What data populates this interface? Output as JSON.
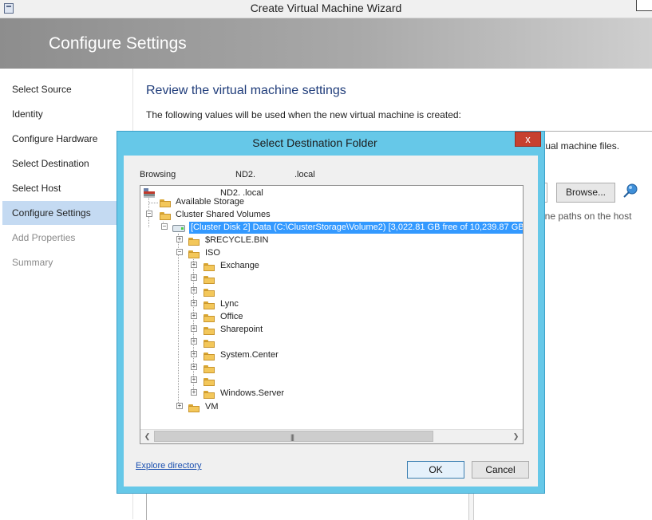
{
  "window": {
    "title": "Create Virtual Machine Wizard"
  },
  "banner": {
    "heading": "Configure Settings"
  },
  "sidebar": {
    "items": [
      {
        "label": "Select Source",
        "state": "normal"
      },
      {
        "label": "Identity",
        "state": "normal"
      },
      {
        "label": "Configure Hardware",
        "state": "normal"
      },
      {
        "label": "Select Destination",
        "state": "normal"
      },
      {
        "label": "Select Host",
        "state": "normal"
      },
      {
        "label": "Configure Settings",
        "state": "active"
      },
      {
        "label": "Add Properties",
        "state": "disabled"
      },
      {
        "label": "Summary",
        "state": "disabled"
      }
    ]
  },
  "main": {
    "title": "Review the virtual machine settings",
    "description": "The following values will be used when the new virtual machine is created:",
    "behind_text_1": "tual machine files.",
    "behind_text_2": "ine paths on the host",
    "browse_label": "Browse..."
  },
  "dialog": {
    "title": "Select Destination Folder",
    "close_label": "x",
    "browsing_label": "Browsing",
    "browsing_server": "ND2.                .local",
    "tree": {
      "root": "ND2.               .local",
      "available_storage": "Available Storage",
      "csv": "Cluster Shared Volumes",
      "volume": "[Cluster Disk 2] Data (C:\\ClusterStorage\\Volume2) [3,022.81 GB free of 10,239.87 GB, C",
      "recycle": "$RECYCLE.BIN",
      "iso": "ISO",
      "iso_children": [
        "Exchange",
        "",
        "",
        "Lync",
        "Office",
        "Sharepoint",
        "",
        "System.Center",
        "",
        "",
        "Windows.Server"
      ],
      "vm": "VM"
    },
    "explore_link": "Explore directory",
    "ok_label": "OK",
    "cancel_label": "Cancel"
  },
  "icons": [
    "app-icon",
    "pin-icon",
    "server-icon",
    "folder-icon",
    "disk-icon",
    "close-icon"
  ]
}
